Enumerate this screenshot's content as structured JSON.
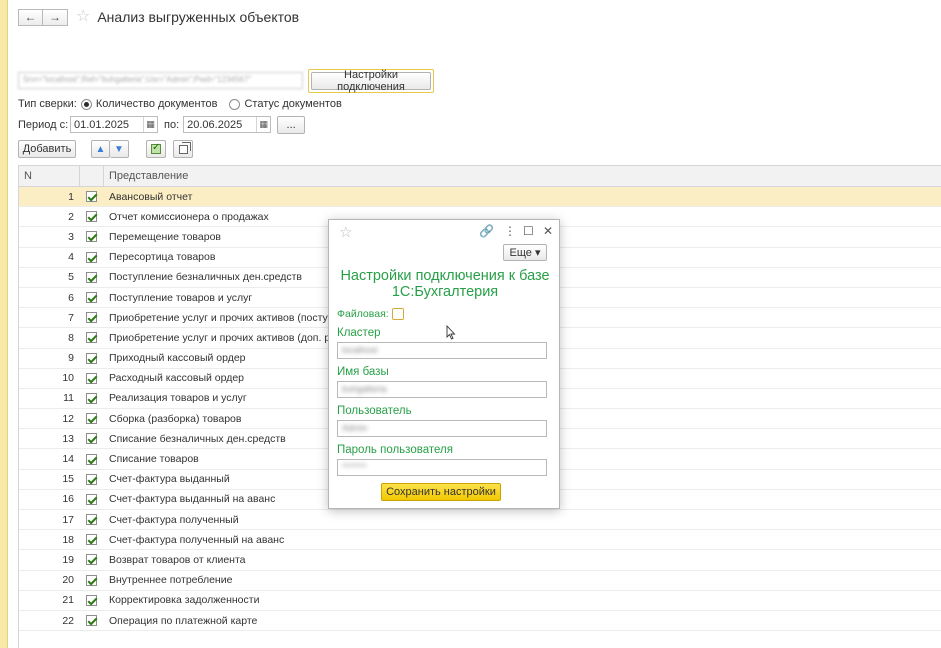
{
  "header": {
    "back_icon": "←",
    "forward_icon": "→",
    "title": "Анализ выгруженных объектов"
  },
  "connection": {
    "value": "Srvr=\"localhost\";Ref=\"buhgalteria\";Usr=\"Admin\";Pwd=\"1234567\"",
    "button_label": "Настройки подключения"
  },
  "check_type": {
    "label": "Тип сверки:",
    "option1": "Количество документов",
    "option2": "Статус документов",
    "selected": "Количество документов"
  },
  "period": {
    "label_from": "Период с:",
    "date_from": "01.01.2025",
    "label_to": "по:",
    "date_to": "20.06.2025",
    "more_label": "..."
  },
  "toolbar": {
    "add_label": "Добавить",
    "up_icon": "▲",
    "down_icon": "▼"
  },
  "table": {
    "col_n": "N",
    "col_name": "Представление",
    "selected_row": 1,
    "rows": [
      {
        "n": "1",
        "name": "Авансовый отчет"
      },
      {
        "n": "2",
        "name": "Отчет комиссионера о продажах"
      },
      {
        "n": "3",
        "name": "Перемещение товаров"
      },
      {
        "n": "4",
        "name": "Пересортица товаров"
      },
      {
        "n": "5",
        "name": "Поступление безналичных ден.средств"
      },
      {
        "n": "6",
        "name": "Поступление товаров и услуг"
      },
      {
        "n": "7",
        "name": "Приобретение услуг и прочих активов (поступление)"
      },
      {
        "n": "8",
        "name": "Приобретение услуг и прочих активов (доп. расходы)"
      },
      {
        "n": "9",
        "name": "Приходный кассовый ордер"
      },
      {
        "n": "10",
        "name": "Расходный кассовый ордер"
      },
      {
        "n": "11",
        "name": "Реализация товаров и услуг"
      },
      {
        "n": "12",
        "name": "Сборка (разборка) товаров"
      },
      {
        "n": "13",
        "name": "Списание безналичных ден.средств"
      },
      {
        "n": "14",
        "name": "Списание товаров"
      },
      {
        "n": "15",
        "name": "Счет-фактура выданный"
      },
      {
        "n": "16",
        "name": "Счет-фактура выданный на аванс"
      },
      {
        "n": "17",
        "name": "Счет-фактура полученный"
      },
      {
        "n": "18",
        "name": "Счет-фактура полученный на аванс"
      },
      {
        "n": "19",
        "name": "Возврат товаров от клиента"
      },
      {
        "n": "20",
        "name": "Внутреннее потребление"
      },
      {
        "n": "21",
        "name": "Корректировка задолженности"
      },
      {
        "n": "22",
        "name": "Операция по платежной карте"
      }
    ]
  },
  "dialog": {
    "link_icon": "🔗",
    "menu_icon": "⋮",
    "maximize_icon": "☐",
    "close_icon": "✕",
    "more_label": "Еще ▾",
    "title_line1": "Настройки подключения к базе",
    "title_line2": "1С:Бухгалтерия",
    "file_label": "Файловая:",
    "cluster_label": "Кластер",
    "cluster_value": "localhost",
    "dbname_label": "Имя базы",
    "dbname_value": "buhgalteria",
    "user_label": "Пользователь",
    "user_value": "Admin",
    "password_label": "Пароль пользователя",
    "password_value": "*******",
    "save_label": "Сохранить настройки"
  }
}
